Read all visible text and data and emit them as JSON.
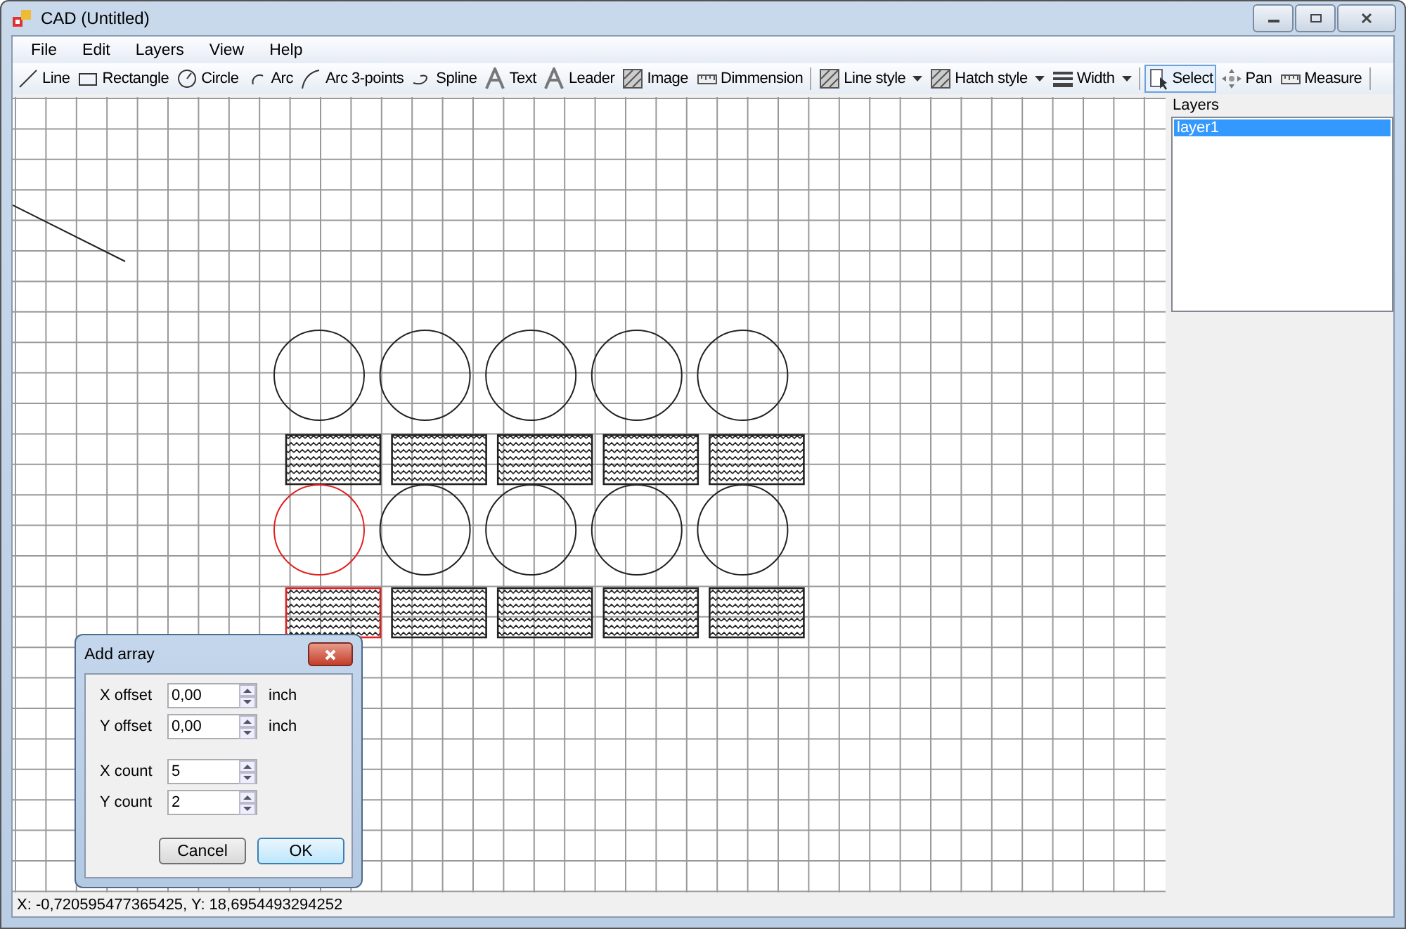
{
  "window": {
    "title": "CAD (Untitled)"
  },
  "menu": [
    "File",
    "Edit",
    "Layers",
    "View",
    "Help"
  ],
  "toolbar": [
    {
      "kind": "tool",
      "label": "Line",
      "selected": false
    },
    {
      "kind": "tool",
      "label": "Rectangle",
      "selected": false
    },
    {
      "kind": "tool",
      "label": "Circle",
      "selected": false
    },
    {
      "kind": "tool",
      "label": "Arc",
      "selected": false
    },
    {
      "kind": "tool",
      "label": "Arc 3-points",
      "selected": false
    },
    {
      "kind": "tool",
      "label": "Spline",
      "selected": false
    },
    {
      "kind": "tool",
      "label": "Text",
      "selected": false
    },
    {
      "kind": "tool",
      "label": "Leader",
      "selected": false
    },
    {
      "kind": "tool",
      "label": "Image",
      "selected": false
    },
    {
      "kind": "tool",
      "label": "Dimmension",
      "selected": false
    },
    {
      "kind": "separator"
    },
    {
      "kind": "dropdown",
      "label": "Line style",
      "selected": false
    },
    {
      "kind": "dropdown",
      "label": "Hatch style",
      "selected": false
    },
    {
      "kind": "dropdown",
      "label": "Width",
      "selected": false
    },
    {
      "kind": "separator"
    },
    {
      "kind": "tool",
      "label": "Select",
      "selected": true
    },
    {
      "kind": "tool",
      "label": "Pan",
      "selected": false
    },
    {
      "kind": "tool",
      "label": "Measure",
      "selected": false
    },
    {
      "kind": "separator"
    }
  ],
  "drawing": {
    "rows": [
      [
        {
          "kind": "circle",
          "selected": false
        },
        {
          "kind": "circle",
          "selected": false
        },
        {
          "kind": "circle",
          "selected": false
        },
        {
          "kind": "circle",
          "selected": false
        },
        {
          "kind": "circle",
          "selected": false
        }
      ],
      [
        {
          "kind": "hatch",
          "selected": false
        },
        {
          "kind": "hatch",
          "selected": false
        },
        {
          "kind": "hatch",
          "selected": false
        },
        {
          "kind": "hatch",
          "selected": false
        },
        {
          "kind": "hatch",
          "selected": false
        }
      ],
      [
        {
          "kind": "circle",
          "selected": true
        },
        {
          "kind": "circle",
          "selected": false
        },
        {
          "kind": "circle",
          "selected": false
        },
        {
          "kind": "circle",
          "selected": false
        },
        {
          "kind": "circle",
          "selected": false
        }
      ],
      [
        {
          "kind": "hatch",
          "selected": true
        },
        {
          "kind": "hatch",
          "selected": false
        },
        {
          "kind": "hatch",
          "selected": false
        },
        {
          "kind": "hatch",
          "selected": false
        },
        {
          "kind": "hatch",
          "selected": false
        }
      ]
    ]
  },
  "layers": {
    "title": "Layers",
    "items": [
      {
        "label": "layer1",
        "selected": true
      }
    ]
  },
  "dialog": {
    "title": "Add array",
    "fields": [
      {
        "label": "X offset",
        "value": "0,00",
        "unit": "inch"
      },
      {
        "label": "Y offset",
        "value": "0,00",
        "unit": "inch"
      },
      {
        "label": "X count",
        "value": "5"
      },
      {
        "label": "Y count",
        "value": "2"
      }
    ],
    "buttons": [
      {
        "label": "Cancel",
        "default": false
      },
      {
        "label": "OK",
        "default": true
      }
    ]
  },
  "status_bar": "X: -0,720595477365425, Y: 18,6954493294252"
}
